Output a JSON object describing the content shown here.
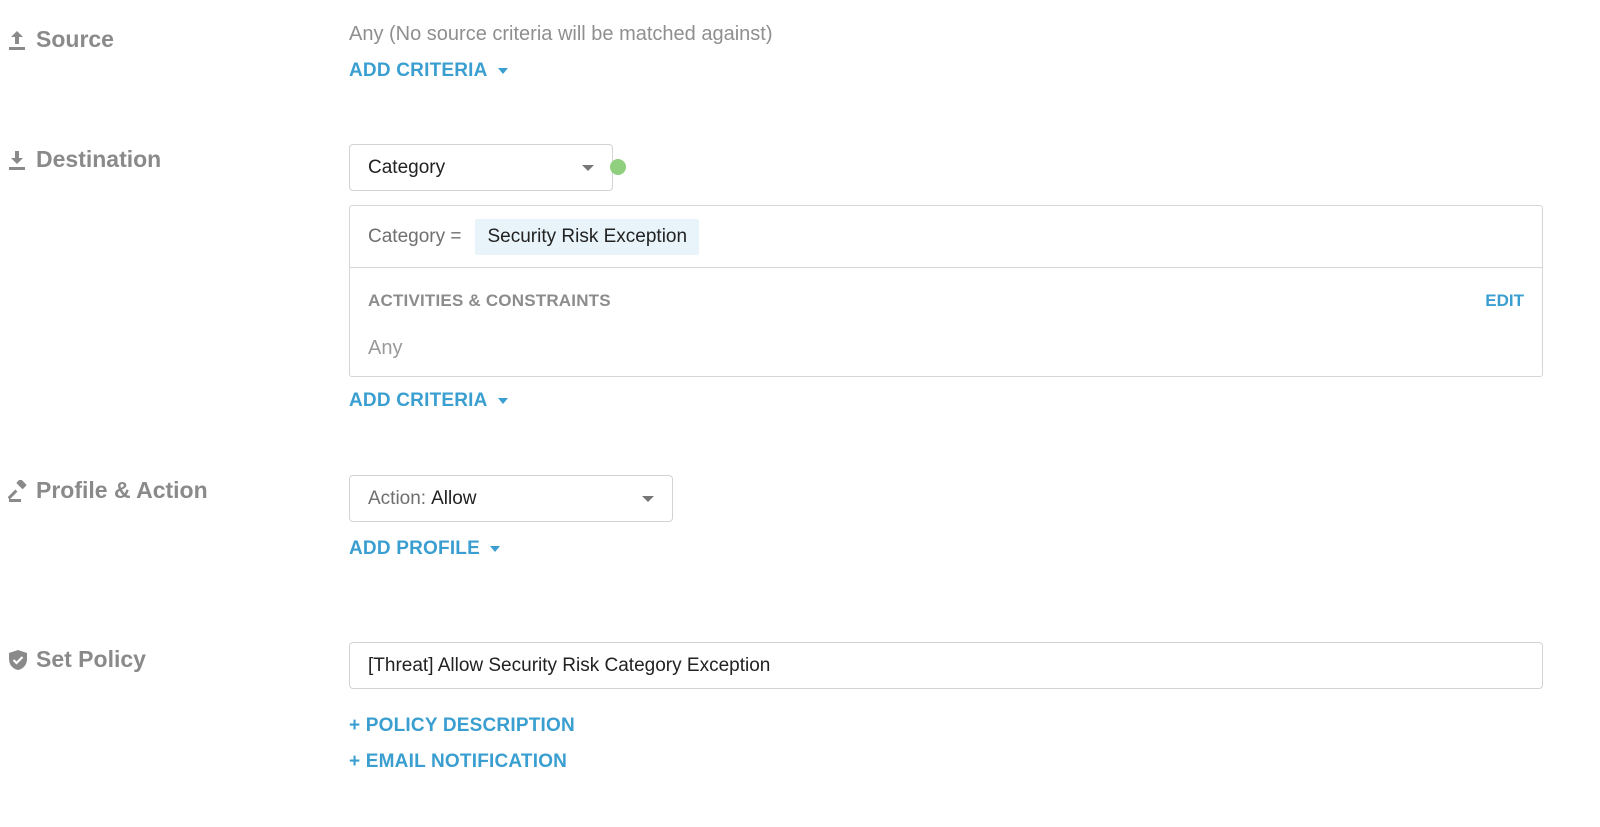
{
  "source": {
    "label": "Source",
    "icon": "upload-icon",
    "summary": "Any (No source criteria will be matched against)",
    "add_criteria": "ADD CRITERIA"
  },
  "destination": {
    "label": "Destination",
    "icon": "download-icon",
    "select_value": "Category",
    "status_color": "#8fcf7e",
    "criteria_key": "Category =",
    "criteria_value": "Security Risk Exception",
    "activities_title": "ACTIVITIES & CONSTRAINTS",
    "edit_label": "EDIT",
    "activities_value": "Any",
    "add_criteria": "ADD CRITERIA"
  },
  "profile_action": {
    "label": "Profile & Action",
    "icon": "gavel-icon",
    "action_prefix": "Action:",
    "action_value": "Allow",
    "add_profile": "ADD PROFILE"
  },
  "set_policy": {
    "label": "Set Policy",
    "icon": "shield-check-icon",
    "policy_name": "[Threat] Allow Security Risk Category Exception",
    "add_description": "+ POLICY DESCRIPTION",
    "add_email": "+ EMAIL NOTIFICATION"
  },
  "colors": {
    "link": "#3a9fd0",
    "label": "#8a8a8a",
    "chip_bg": "#e9f4fa"
  }
}
